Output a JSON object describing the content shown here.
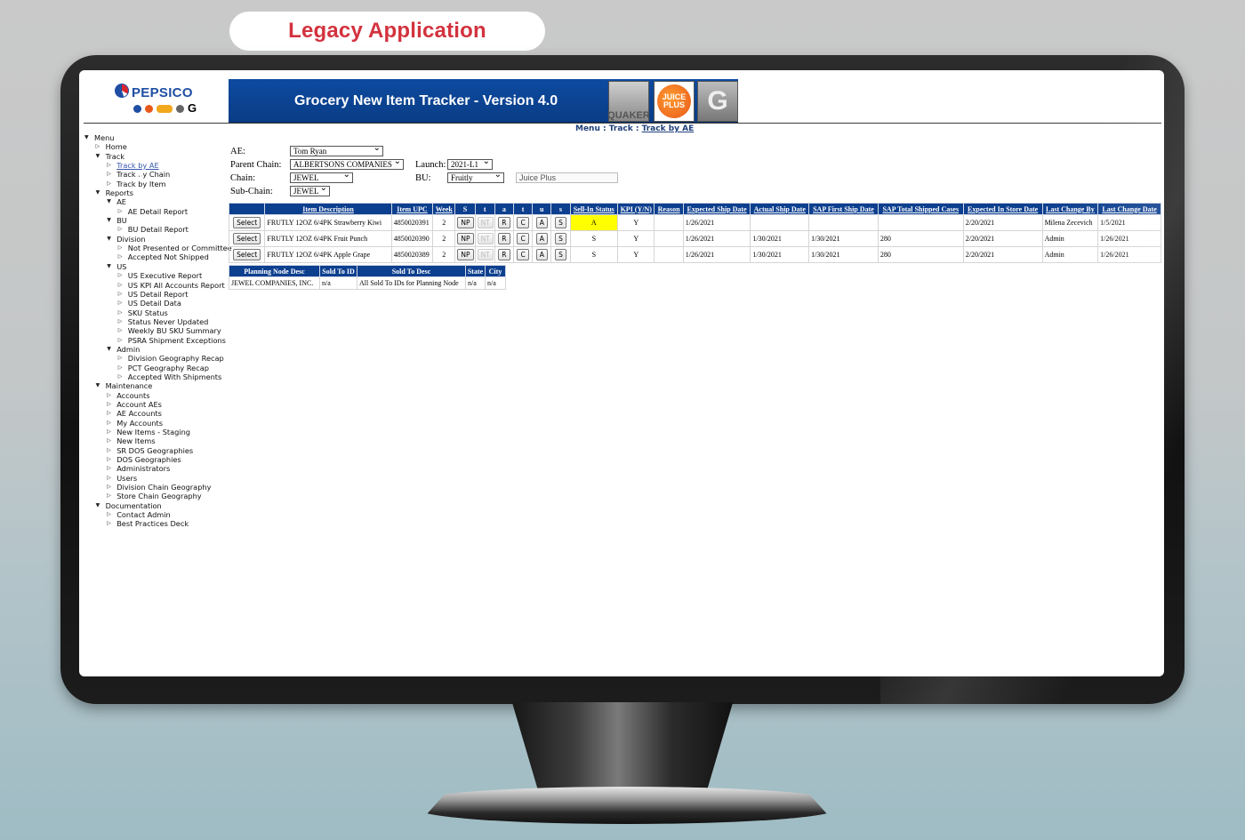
{
  "badge": {
    "label": "Legacy Application"
  },
  "app": {
    "logo_text": "PEPSICO",
    "banner_title": "Grocery New Item Tracker - Version 4.0",
    "brand_tiles": [
      "QUAKER",
      "JUICE PLUS",
      "G"
    ],
    "brand_icons": [
      "quaker-icon",
      "juice-plus-icon",
      "gatorade-icon"
    ]
  },
  "breadcrumb": {
    "prefix": "Menu : Track : ",
    "current": "Track by AE"
  },
  "tree": [
    {
      "label": "Menu",
      "level": 0,
      "open": true
    },
    {
      "label": "Home",
      "level": 1,
      "open": false
    },
    {
      "label": "Track",
      "level": 1,
      "open": true
    },
    {
      "label": "Track by AE",
      "level": 2,
      "open": false,
      "link": true
    },
    {
      "label": "Track by Chain",
      "level": 2,
      "open": false
    },
    {
      "label": "Track by Item",
      "level": 2,
      "open": false
    },
    {
      "label": "Reports",
      "level": 1,
      "open": true
    },
    {
      "label": "AE",
      "level": 2,
      "open": true
    },
    {
      "label": "AE Detail Report",
      "level": 3,
      "open": false
    },
    {
      "label": "BU",
      "level": 2,
      "open": true
    },
    {
      "label": "BU Detail Report",
      "level": 3,
      "open": false
    },
    {
      "label": "Division",
      "level": 2,
      "open": true
    },
    {
      "label": "Not Presented or Committee",
      "level": 3,
      "open": false
    },
    {
      "label": "Accepted Not Shipped",
      "level": 3,
      "open": false
    },
    {
      "label": "US",
      "level": 2,
      "open": true
    },
    {
      "label": "US Executive Report",
      "level": 3,
      "open": false
    },
    {
      "label": "US KPI All Accounts Report",
      "level": 3,
      "open": false
    },
    {
      "label": "US Detail Report",
      "level": 3,
      "open": false
    },
    {
      "label": "US Detail Data",
      "level": 3,
      "open": false
    },
    {
      "label": "SKU Status",
      "level": 3,
      "open": false
    },
    {
      "label": "Status Never Updated",
      "level": 3,
      "open": false
    },
    {
      "label": "Weekly BU SKU Summary",
      "level": 3,
      "open": false
    },
    {
      "label": "PSRA Shipment Exceptions",
      "level": 3,
      "open": false
    },
    {
      "label": "Admin",
      "level": 2,
      "open": true
    },
    {
      "label": "Division Geography Recap",
      "level": 3,
      "open": false
    },
    {
      "label": "PCT Geography Recap",
      "level": 3,
      "open": false
    },
    {
      "label": "Accepted With Shipments",
      "level": 3,
      "open": false
    },
    {
      "label": "Maintenance",
      "level": 1,
      "open": true
    },
    {
      "label": "Accounts",
      "level": 2,
      "open": false
    },
    {
      "label": "Account AEs",
      "level": 2,
      "open": false
    },
    {
      "label": "AE Accounts",
      "level": 2,
      "open": false
    },
    {
      "label": "My Accounts",
      "level": 2,
      "open": false
    },
    {
      "label": "New Items - Staging",
      "level": 2,
      "open": false
    },
    {
      "label": "New Items",
      "level": 2,
      "open": false
    },
    {
      "label": "SR DOS Geographies",
      "level": 2,
      "open": false
    },
    {
      "label": "DOS Geographies",
      "level": 2,
      "open": false
    },
    {
      "label": "Administrators",
      "level": 2,
      "open": false
    },
    {
      "label": "Users",
      "level": 2,
      "open": false
    },
    {
      "label": "Division Chain Geography",
      "level": 2,
      "open": false
    },
    {
      "label": "Store Chain Geography",
      "level": 2,
      "open": false
    },
    {
      "label": "Documentation",
      "level": 1,
      "open": true
    },
    {
      "label": "Contact Admin",
      "level": 2,
      "open": false
    },
    {
      "label": "Best Practices Deck",
      "level": 2,
      "open": false
    }
  ],
  "filters": {
    "ae_label": "AE:",
    "ae_value": "Tom Ryan",
    "parent_chain_label": "Parent Chain:",
    "parent_chain_value": "ALBERTSONS COMPANIES",
    "launch_label": "Launch:",
    "launch_value": "2021-L1",
    "chain_label": "Chain:",
    "chain_value": "JEWEL",
    "bu_label": "BU:",
    "bu_value": "Fruitly",
    "brand_value": "Juice Plus",
    "subchain_label": "Sub-Chain:",
    "subchain_value": "JEWEL"
  },
  "items_table": {
    "headers": [
      "",
      "Item Description",
      "Item UPC",
      "Week",
      "S",
      "t",
      "a",
      "t",
      "u",
      "s",
      "Sell-In Status",
      "KPI (Y/N)",
      "Reason",
      "Expected Ship Date",
      "Actual Ship Date",
      "SAP First Ship Date",
      "SAP Total Shipped Cases",
      "Expected In Store Date",
      "Last Change By",
      "Last Change Date"
    ],
    "select_label": "Select",
    "status_buttons": [
      "NP",
      "NT",
      "R",
      "C",
      "A",
      "S"
    ],
    "rows": [
      {
        "desc": "FRUTLY 12OZ 6/4PK Strawberry Kiwi",
        "upc": "4850020391",
        "week": "2",
        "sell_in": "A",
        "kpi": "Y",
        "reason": "",
        "exp_ship": "1/26/2021",
        "act_ship": "",
        "sap_first": "",
        "sap_cases": "",
        "exp_store": "2/20/2021",
        "changed_by": "Milena Zecevich",
        "changed_date": "1/5/2021"
      },
      {
        "desc": "FRUTLY 12OZ 6/4PK Fruit Punch",
        "upc": "4850020390",
        "week": "2",
        "sell_in": "S",
        "kpi": "Y",
        "reason": "",
        "exp_ship": "1/26/2021",
        "act_ship": "1/30/2021",
        "sap_first": "1/30/2021",
        "sap_cases": "280",
        "exp_store": "2/20/2021",
        "changed_by": "Admin",
        "changed_date": "1/26/2021"
      },
      {
        "desc": "FRUTLY 12OZ 6/4PK Apple Grape",
        "upc": "4850020389",
        "week": "2",
        "sell_in": "S",
        "kpi": "Y",
        "reason": "",
        "exp_ship": "1/26/2021",
        "act_ship": "1/30/2021",
        "sap_first": "1/30/2021",
        "sap_cases": "280",
        "exp_store": "2/20/2021",
        "changed_by": "Admin",
        "changed_date": "1/26/2021"
      }
    ]
  },
  "planning_table": {
    "headers": [
      "Planning Node Desc",
      "Sold To ID",
      "Sold To Desc",
      "State",
      "City"
    ],
    "rows": [
      [
        "JEWEL COMPANIES, INC.",
        "n/a",
        "All Sold To IDs for Planning Node",
        "n/a",
        "n/a"
      ]
    ]
  },
  "colors": {
    "banner": "#0d4aa0",
    "header_cell": "#0d3f8f",
    "badge_text": "#d3323e",
    "highlight": "#ffff00"
  }
}
